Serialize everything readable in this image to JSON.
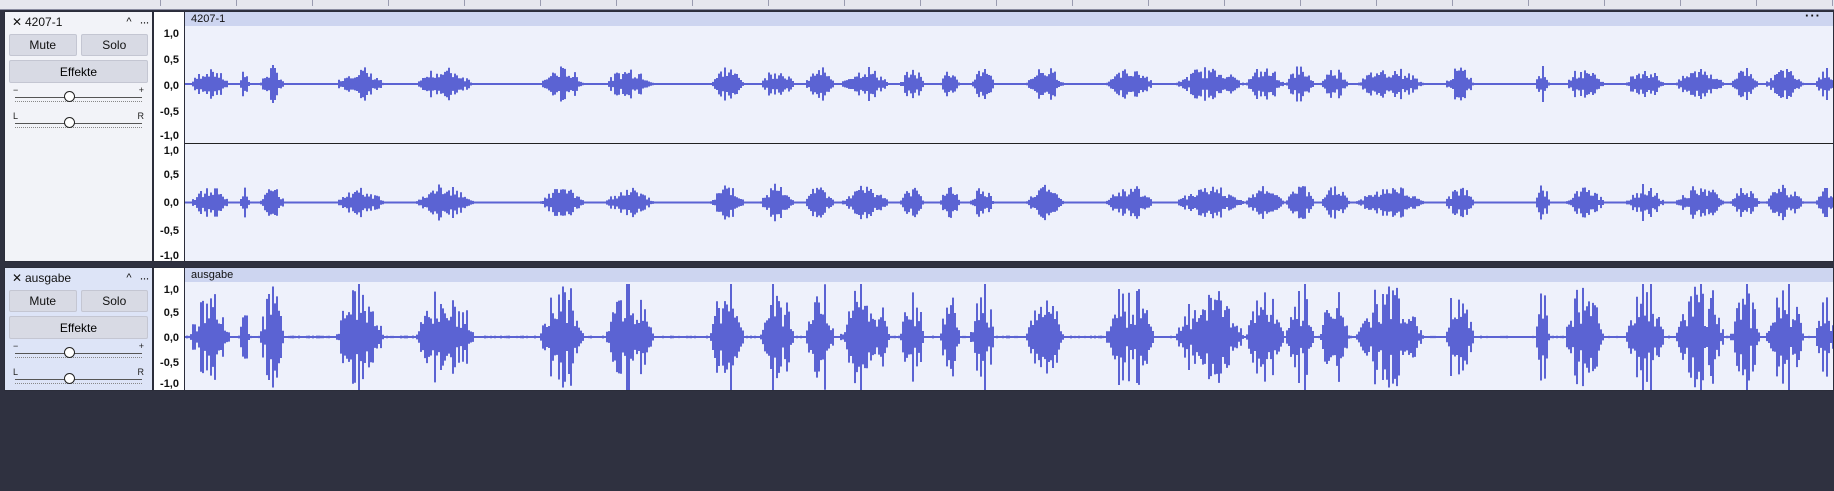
{
  "tracks": [
    {
      "id": "track1",
      "name": "4207-1",
      "clip_name": "4207-1",
      "mute_label": "Mute",
      "solo_label": "Solo",
      "effects_label": "Effekte",
      "gain_minus": "−",
      "gain_plus": "+",
      "pan_left": "L",
      "pan_right": "R",
      "selected": false,
      "menu_glyph": "···",
      "channels": 2,
      "scale_labels": [
        "1,0",
        "0,5",
        "0,0",
        "-0,5",
        "-1,0"
      ],
      "scale_labels_ch2": [
        "1,0",
        "0,5",
        "0,0",
        "-0,5",
        "-1,0"
      ]
    },
    {
      "id": "track2",
      "name": "ausgabe",
      "clip_name": "ausgabe",
      "mute_label": "Mute",
      "solo_label": "Solo",
      "effects_label": "Effekte",
      "gain_minus": "−",
      "gain_plus": "+",
      "pan_left": "L",
      "pan_right": "R",
      "selected": true,
      "menu_glyph": "···",
      "channels": 1,
      "scale_labels": [
        "1,0",
        "0,5",
        "0,0",
        "-0,5",
        "-1,0"
      ]
    }
  ],
  "icons": {
    "close": "close-icon",
    "collapse": "chevron-up-icon",
    "menu": "more-icon"
  },
  "colors": {
    "waveform": "#5b63d3",
    "clip_bg": "#eef1fb",
    "clip_header": "#cdd5f0",
    "selected_panel": "#dde4f7"
  }
}
